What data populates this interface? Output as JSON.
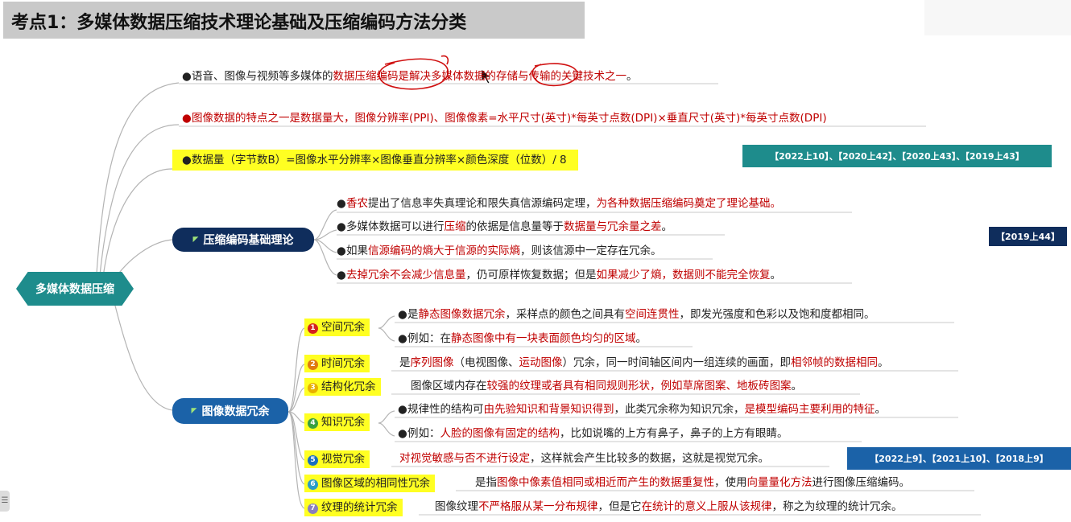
{
  "title": "考点1：多媒体数据压缩技术理论基础及压缩编码方法分类",
  "root": {
    "label": "多媒体数据压缩"
  },
  "bullet": "●",
  "top_items": {
    "i1": {
      "a": "语音、图像与视频等多媒体的",
      "b": "数据压缩编码是解决多媒体数据的存储与传输的关键技术之一",
      "c": "。"
    },
    "i2": {
      "text": "图像数据的特点之一是数据量大，图像分辨率(PPI)、图像像素=水平尺寸(英寸)*每英寸点数(DPI)×垂直尺寸(英寸)*每英寸点数(DPI)"
    },
    "i3": {
      "text": "数据量（字节数B）=图像水平分辨率×图像垂直分辨率×颜色深度（位数）/ 8"
    }
  },
  "tags": {
    "t1": "【2022上10】、【2020上42】、【2020上43】、【2019上43】",
    "t2": "【2019上44】",
    "t3": "【2022上9】、【2021上10】、【2018上9】"
  },
  "theory": {
    "label": "压缩编码基础理论",
    "items": {
      "i1": {
        "a": "香农",
        "b": "提出了信息率失真理论和限失真信源编码定理，",
        "c": "为各种数据压缩编码奠定了理论基础。"
      },
      "i2": {
        "a": "多媒体数据可以进行",
        "b": "压缩",
        "c": "的依据是信息量等于",
        "d": "数据量与冗余量之差",
        "e": "。"
      },
      "i3": {
        "a": "如果",
        "b": "信源编码的熵大于信源的实际熵",
        "c": "，则该信源中一定存在冗余。"
      },
      "i4": {
        "a": "去掉冗余不会减少信息量",
        "b": "，仍可原样恢复数据；但是",
        "c": "如果减少了熵，数据则不能完全恢复",
        "d": "。"
      }
    }
  },
  "redundancy": {
    "label": "图像数据冗余",
    "spatial": {
      "num": "1",
      "label": "空间冗余",
      "d1": {
        "a": "是",
        "b": "静态图像数据冗余",
        "c": "，采样点的颜色之间具有",
        "d": "空间连贯性",
        "e": "，即发光强度和色彩以及饱和度都相同。"
      },
      "d2": {
        "a": "例如：在",
        "b": "静态图像中有一块表面颜色均匀的区域",
        "c": "。"
      }
    },
    "temporal": {
      "num": "2",
      "label": "时间冗余",
      "d1": {
        "a": "是",
        "b": "序列图像",
        "c": "（电视图像、",
        "d": "运动图像",
        "e": "）冗余，同一时间轴区间内一组连续的画面，即",
        "f": "相邻帧的数据相同",
        "g": "。"
      }
    },
    "structural": {
      "num": "3",
      "label": "结构化冗余",
      "d1": {
        "a": "图像区域内存在",
        "b": "较强的纹理或者具有相同规则形状，例如草席图案、地板砖图案",
        "c": "。"
      }
    },
    "knowledge": {
      "num": "4",
      "label": "知识冗余",
      "d1": {
        "a": "规律性的结构可",
        "b": "由先验知识和背景知识得到",
        "c": "，此类冗余称为知识冗余，",
        "d": "是模型编码主要利用的特征",
        "e": "。"
      },
      "d2": {
        "a": "例如：",
        "b": "人脸的图像有固定的结构",
        "c": "，比如说嘴的上方有鼻子，鼻子的上方有眼睛。"
      }
    },
    "visual": {
      "num": "5",
      "label": "视觉冗余",
      "d1": {
        "a": "对视觉敏感与否不进行设定",
        "b": "，这样就会产生比较多的数据，这就是视觉冗余。"
      }
    },
    "region": {
      "num": "6",
      "label": "图像区域的相同性冗余",
      "d1": {
        "a": "是指",
        "b": "图像中像素值相同或相近而产生的数据重复性",
        "c": "，使用",
        "d": "向量量化方法",
        "e": "进行图像压缩编码。"
      }
    },
    "texture": {
      "num": "7",
      "label": "纹理的统计冗余",
      "d1": {
        "a": "图像纹理",
        "b": "不严格服从某一分布规律",
        "c": "，但是它",
        "d": "在统计的意义上服从该规律",
        "e": "，称之为纹理的统计冗余。"
      }
    }
  },
  "colors": {
    "root": "#1e8c8c",
    "theory": "#0f2d5c",
    "redundancy": "#1b62a8",
    "highlight": "#ffff22",
    "emphasis": "#c00000",
    "annotation": "#d01010",
    "num1": "#d42020",
    "num2": "#e07a10",
    "num3": "#e8b000",
    "num4": "#3aa040",
    "num5": "#1a6fc0",
    "num6": "#2a9cc8",
    "num7": "#8a7fbf"
  },
  "icons": {
    "flag": "flag-icon",
    "annotation": "pen-annotation",
    "cursor": "mouse-cursor-icon",
    "handle": "sidebar-handle-icon"
  }
}
